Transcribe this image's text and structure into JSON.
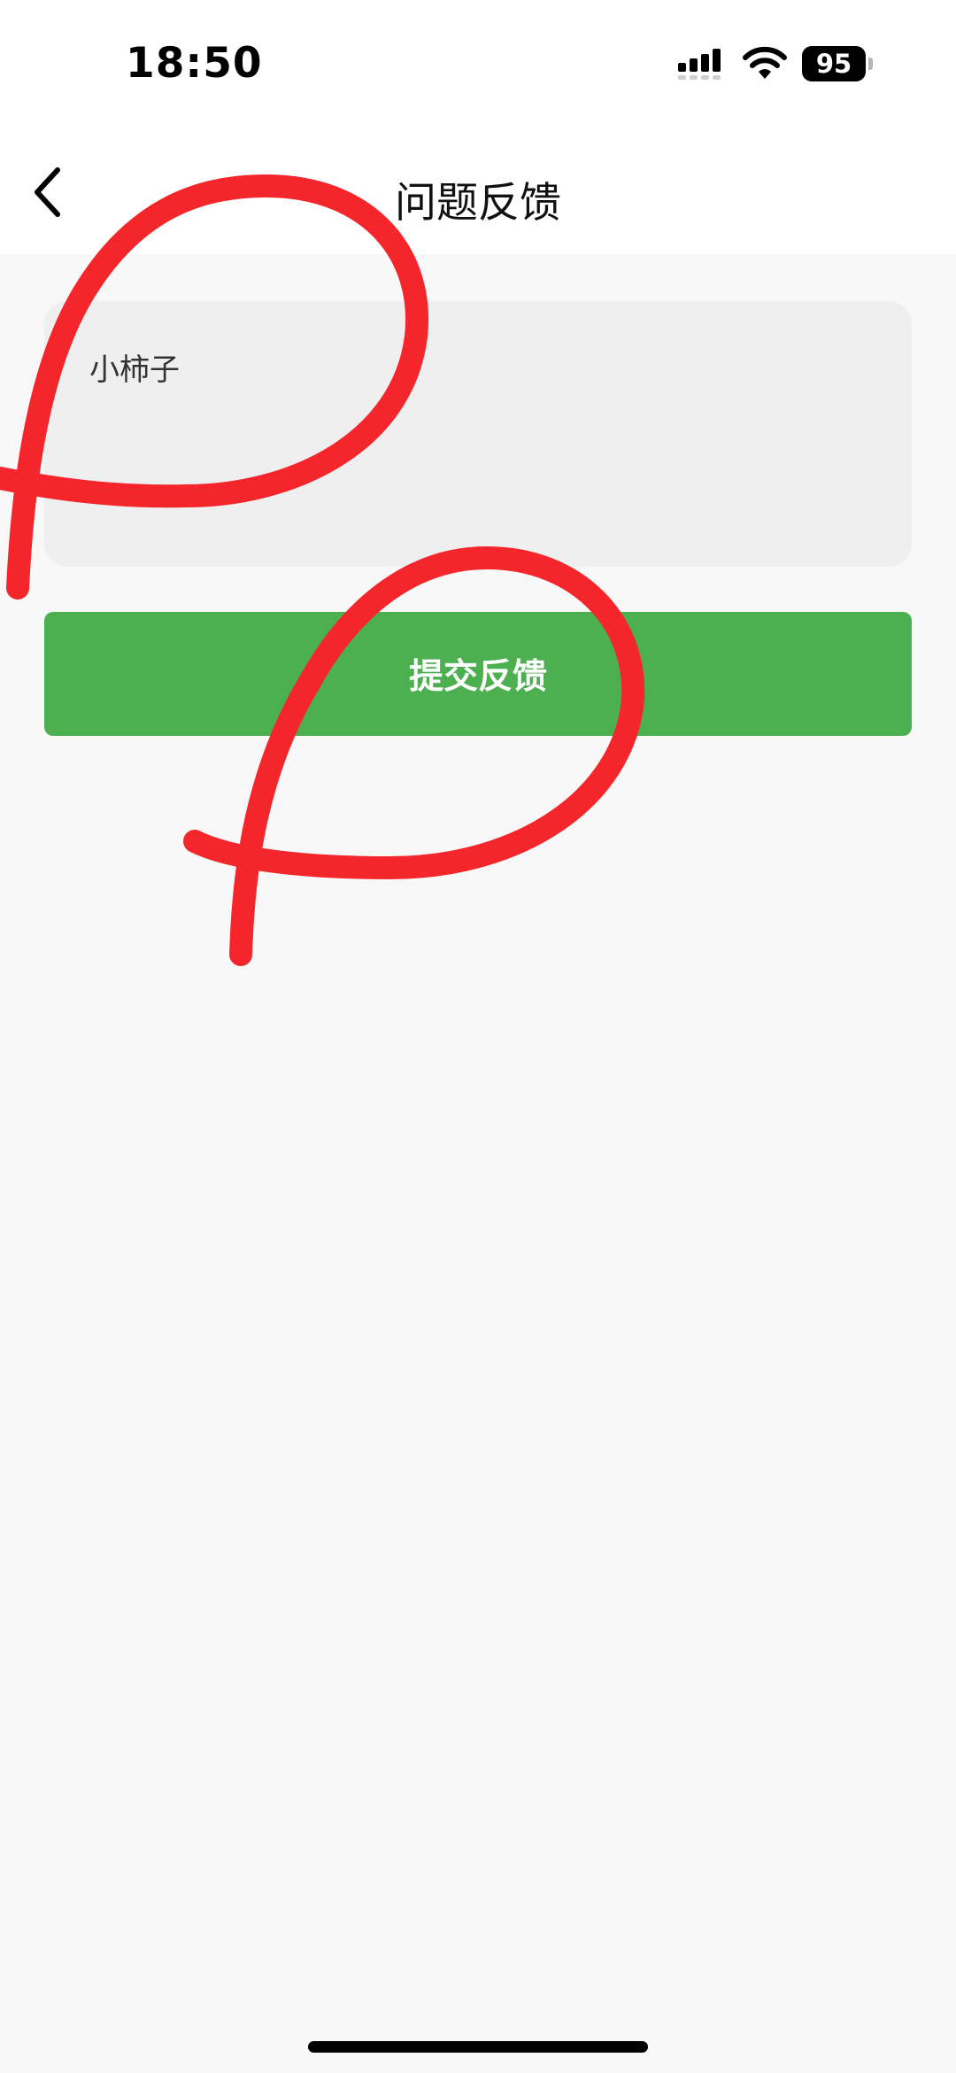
{
  "status_bar": {
    "time": "18:50",
    "battery": "95",
    "icons": [
      "signal-icon",
      "wifi-icon",
      "battery-icon"
    ]
  },
  "nav": {
    "title": "问题反馈",
    "back_icon": "chevron-left-icon"
  },
  "feedback": {
    "value": "小柿子"
  },
  "submit": {
    "label": "提交反馈"
  },
  "colors": {
    "submit_bg": "#4caf50",
    "field_bg": "#efefef",
    "page_bg": "#f8f8f8",
    "annotation": "#f5262b"
  }
}
